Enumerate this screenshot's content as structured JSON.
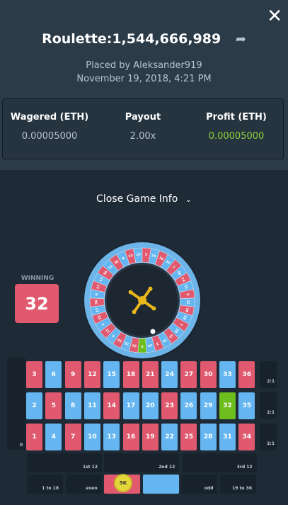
{
  "header": {
    "title": "Roulette:1,544,666,989",
    "placed_by": "Placed by Aleksander919",
    "date": "November 19, 2018, 4:21 PM",
    "close_icon": "close-icon",
    "share_icon": "share-arrow-icon"
  },
  "stats": {
    "wagered_label": "Wagered (ETH)",
    "wagered_value": "0.00005000",
    "payout_label": "Payout",
    "payout_value": "2.00x",
    "profit_label": "Profit (ETH)",
    "profit_value": "0.00005000"
  },
  "toggle": {
    "label": "Close Game Info",
    "icon": "chevron-down-icon"
  },
  "winning": {
    "label": "WINNING",
    "number": "32"
  },
  "wheel_numbers": [
    "0",
    "32",
    "15",
    "19",
    "4",
    "21",
    "2",
    "25",
    "17",
    "34",
    "6",
    "27",
    "13",
    "36",
    "11",
    "30",
    "8",
    "23",
    "10",
    "5",
    "24",
    "16",
    "33",
    "1",
    "20",
    "14",
    "31",
    "9",
    "22",
    "18",
    "29",
    "7",
    "28",
    "12",
    "35",
    "3",
    "26"
  ],
  "table": {
    "zero": "0",
    "rows": [
      [
        {
          "n": "3",
          "c": "red"
        },
        {
          "n": "6",
          "c": "blue"
        },
        {
          "n": "9",
          "c": "red"
        },
        {
          "n": "12",
          "c": "red"
        },
        {
          "n": "15",
          "c": "blue"
        },
        {
          "n": "18",
          "c": "red"
        },
        {
          "n": "21",
          "c": "red"
        },
        {
          "n": "24",
          "c": "blue"
        },
        {
          "n": "27",
          "c": "red"
        },
        {
          "n": "30",
          "c": "red"
        },
        {
          "n": "33",
          "c": "blue"
        },
        {
          "n": "36",
          "c": "red"
        }
      ],
      [
        {
          "n": "2",
          "c": "blue"
        },
        {
          "n": "5",
          "c": "red"
        },
        {
          "n": "8",
          "c": "blue"
        },
        {
          "n": "11",
          "c": "blue"
        },
        {
          "n": "14",
          "c": "red"
        },
        {
          "n": "17",
          "c": "blue"
        },
        {
          "n": "20",
          "c": "blue"
        },
        {
          "n": "23",
          "c": "red"
        },
        {
          "n": "26",
          "c": "blue"
        },
        {
          "n": "29",
          "c": "blue"
        },
        {
          "n": "32",
          "c": "green"
        },
        {
          "n": "35",
          "c": "blue"
        }
      ],
      [
        {
          "n": "1",
          "c": "red"
        },
        {
          "n": "4",
          "c": "blue"
        },
        {
          "n": "7",
          "c": "red"
        },
        {
          "n": "10",
          "c": "blue"
        },
        {
          "n": "13",
          "c": "blue"
        },
        {
          "n": "16",
          "c": "red"
        },
        {
          "n": "19",
          "c": "red"
        },
        {
          "n": "22",
          "c": "blue"
        },
        {
          "n": "25",
          "c": "red"
        },
        {
          "n": "28",
          "c": "blue"
        },
        {
          "n": "31",
          "c": "blue"
        },
        {
          "n": "34",
          "c": "red"
        }
      ]
    ],
    "column_labels": [
      "2:1",
      "2:1",
      "2:1"
    ],
    "dozens": [
      "1st 12",
      "2nd 12",
      "3rd 12"
    ],
    "outside": [
      "1 to 18",
      "even",
      "",
      "",
      "odd",
      "19 to 36"
    ],
    "chip_label": "5K"
  }
}
